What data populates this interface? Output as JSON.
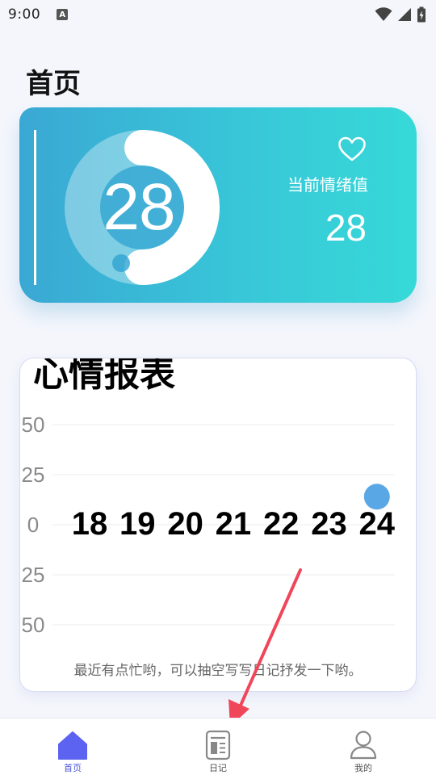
{
  "status_bar": {
    "time": "9:00",
    "notification_letter": "A",
    "icons": [
      "wifi-icon",
      "signal-icon",
      "battery-icon"
    ]
  },
  "page": {
    "title": "首页"
  },
  "mood_card": {
    "ring_value": "28",
    "label": "当前情绪值",
    "value": "28",
    "icon": "heart-icon",
    "gradient": [
      "#3aa8d4",
      "#36d9d8"
    ]
  },
  "report": {
    "title": "心情报表",
    "message": "最近有点忙哟，可以抽空写写日记抒发一下哟。"
  },
  "chart_data": {
    "type": "scatter",
    "title": "心情报表",
    "y_tick_labels": [
      "50",
      "25",
      "0",
      "25",
      "50"
    ],
    "x_tick_labels": [
      "18",
      "19",
      "20",
      "21",
      "22",
      "23",
      "24"
    ],
    "ylim": [
      -50,
      50
    ],
    "grid": true,
    "points": [
      {
        "x": "24",
        "y": 14
      }
    ],
    "point_color": "#5aa7e6"
  },
  "bottom_nav": {
    "items": [
      {
        "label": "首页",
        "icon": "home-icon",
        "active": true
      },
      {
        "label": "日记",
        "icon": "diary-icon",
        "active": false
      },
      {
        "label": "我的",
        "icon": "profile-icon",
        "active": false
      }
    ],
    "active_color": "#5b63f0"
  }
}
